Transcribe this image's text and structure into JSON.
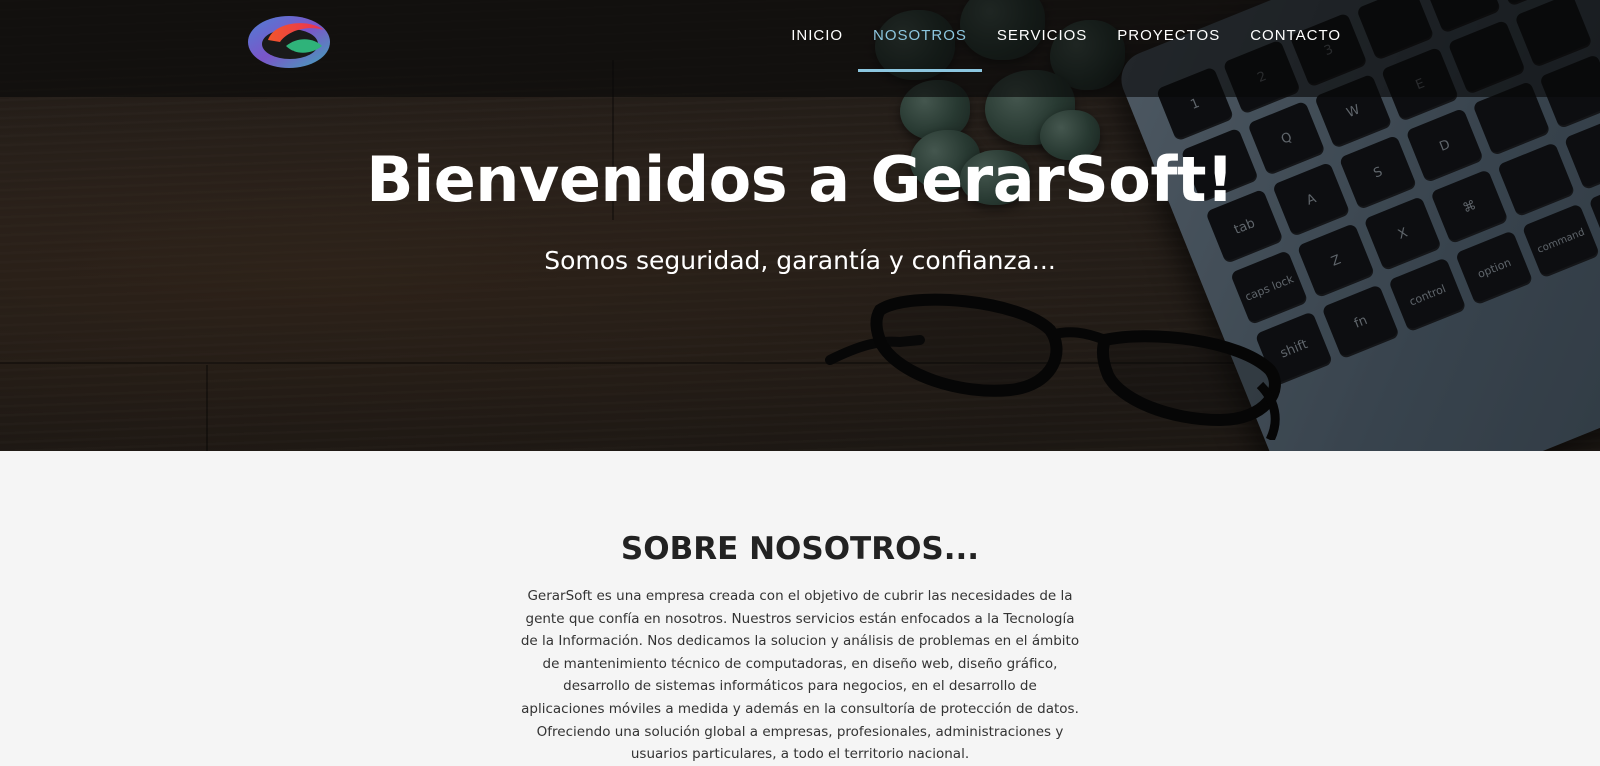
{
  "brand": {
    "logo_alt": "GerarSoft logo"
  },
  "nav": {
    "items": [
      {
        "label": "INICIO"
      },
      {
        "label": "NOSOTROS",
        "active": true
      },
      {
        "label": "SERVICIOS"
      },
      {
        "label": "PROYECTOS"
      },
      {
        "label": "CONTACTO"
      }
    ]
  },
  "hero": {
    "title": "Bienvenidos a GerarSoft!",
    "subtitle": "Somos seguridad, garantía y confianza..."
  },
  "about": {
    "title": "SOBRE NOSOTROS...",
    "text": "GerarSoft es una empresa creada con el objetivo de cubrir las necesidades de la gente que confía en nosotros. Nuestros servicios están enfocados a la Tecnología de la Información. Nos dedicamos la solucion y análisis de problemas en el ámbito de mantenimiento técnico de computadoras, en diseño web, diseño gráfico, desarrollo de sistemas informáticos para negocios, en el desarrollo de aplicaciones móviles a medida y además en la consultoría de protección de datos. Ofreciendo una solución global a empresas, profesionales, administraciones y usuarios particulares, a todo el territorio nacional."
  },
  "keyboard": {
    "keys": [
      "1",
      "2",
      "3",
      "",
      "",
      "",
      "~",
      "Q",
      "W",
      "E",
      "",
      "",
      "tab",
      "A",
      "S",
      "D",
      "",
      "",
      "caps lock",
      "Z",
      "X",
      "⌘",
      "",
      "",
      "shift",
      "fn",
      "control",
      "option",
      "command",
      ""
    ]
  },
  "colors": {
    "accent": "#8cc6df",
    "navbar_bg": "#141414",
    "section_bg": "#f5f5f5",
    "title_color": "#222222"
  }
}
